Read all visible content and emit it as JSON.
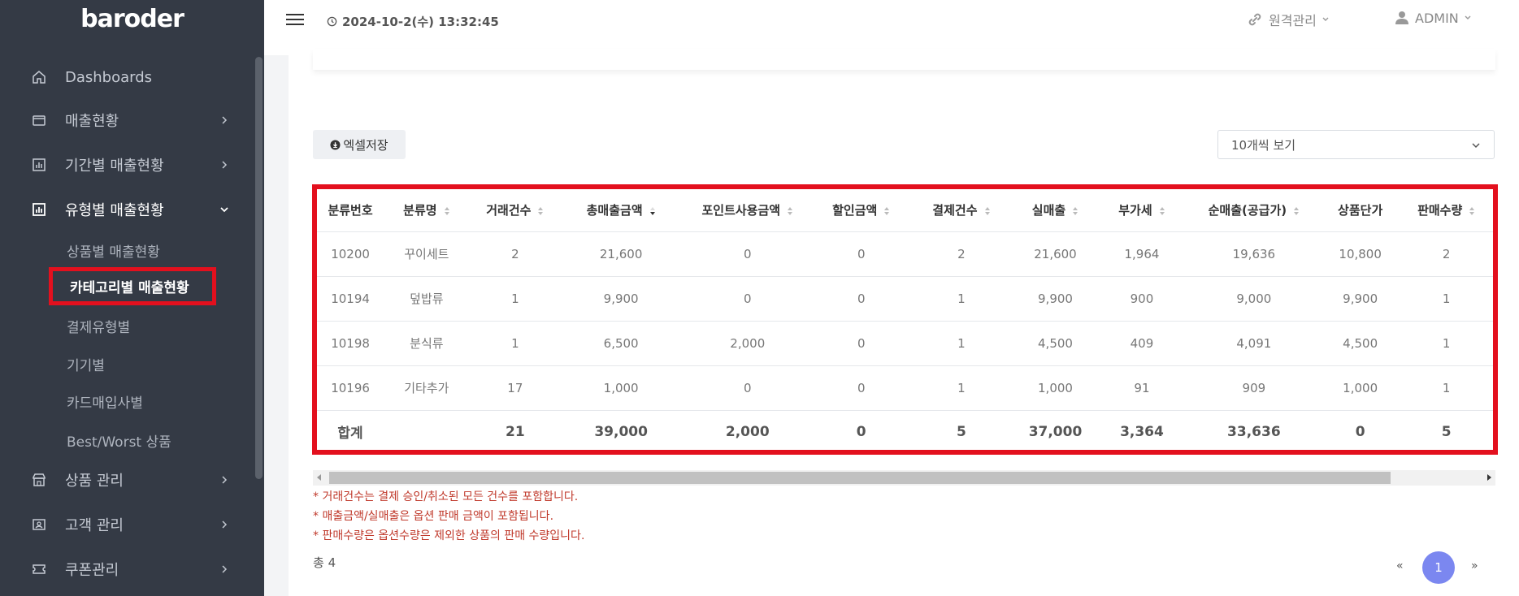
{
  "app": {
    "brand": "baroder"
  },
  "sidebar": {
    "items": [
      {
        "label": "Dashboards",
        "icon": "home-icon"
      },
      {
        "label": "매출현황",
        "icon": "wallet-icon"
      },
      {
        "label": "기간별 매출현황",
        "icon": "bar-chart-icon"
      },
      {
        "label": "유형별 매출현황",
        "icon": "chart-square-icon"
      },
      {
        "label": "상품 관리",
        "icon": "store-icon"
      },
      {
        "label": "고객 관리",
        "icon": "id-card-icon"
      },
      {
        "label": "쿠폰관리",
        "icon": "ticket-icon"
      }
    ],
    "sub_items": [
      {
        "label": "상품별 매출현황"
      },
      {
        "label": "카테고리별 매출현황"
      },
      {
        "label": "결제유형별"
      },
      {
        "label": "기기별"
      },
      {
        "label": "카드매입사별"
      },
      {
        "label": "Best/Worst 상품"
      }
    ]
  },
  "topbar": {
    "datetime": "2024-10-2(수) 13:32:45",
    "remote_label": "원격관리",
    "admin_label": "ADMIN"
  },
  "toolbar": {
    "excel_label": "엑셀저장",
    "page_size": "10개씩 보기"
  },
  "table": {
    "headers": [
      "분류번호",
      "분류명",
      "거래건수",
      "총매출금액",
      "포인트사용금액",
      "할인금액",
      "결제건수",
      "실매출",
      "부가세",
      "순매출(공급가)",
      "상품단가",
      "판매수량"
    ],
    "rows": [
      [
        "10200",
        "꾸이세트",
        "2",
        "21,600",
        "0",
        "0",
        "2",
        "21,600",
        "1,964",
        "19,636",
        "10,800",
        "2"
      ],
      [
        "10194",
        "덮밥류",
        "1",
        "9,900",
        "0",
        "0",
        "1",
        "9,900",
        "900",
        "9,000",
        "9,900",
        "1"
      ],
      [
        "10198",
        "분식류",
        "1",
        "6,500",
        "2,000",
        "0",
        "1",
        "4,500",
        "409",
        "4,091",
        "4,500",
        "1"
      ],
      [
        "10196",
        "기타추가",
        "17",
        "1,000",
        "0",
        "0",
        "1",
        "1,000",
        "91",
        "909",
        "1,000",
        "1"
      ]
    ],
    "total": [
      "합계",
      "",
      "21",
      "39,000",
      "2,000",
      "0",
      "5",
      "37,000",
      "3,364",
      "33,636",
      "0",
      "5"
    ]
  },
  "notes": [
    "* 거래건수는 결제 승인/취소된 모든 건수를 포함합니다.",
    "* 매출금액/실매출은 옵션 판매 금액이 포함됩니다.",
    "* 판매수량은 옵션수량은 제외한 상품의 판매 수량입니다."
  ],
  "footer": {
    "total_count": "총 4",
    "pager_prev": "«",
    "pager_current": "1",
    "pager_next": "»"
  }
}
